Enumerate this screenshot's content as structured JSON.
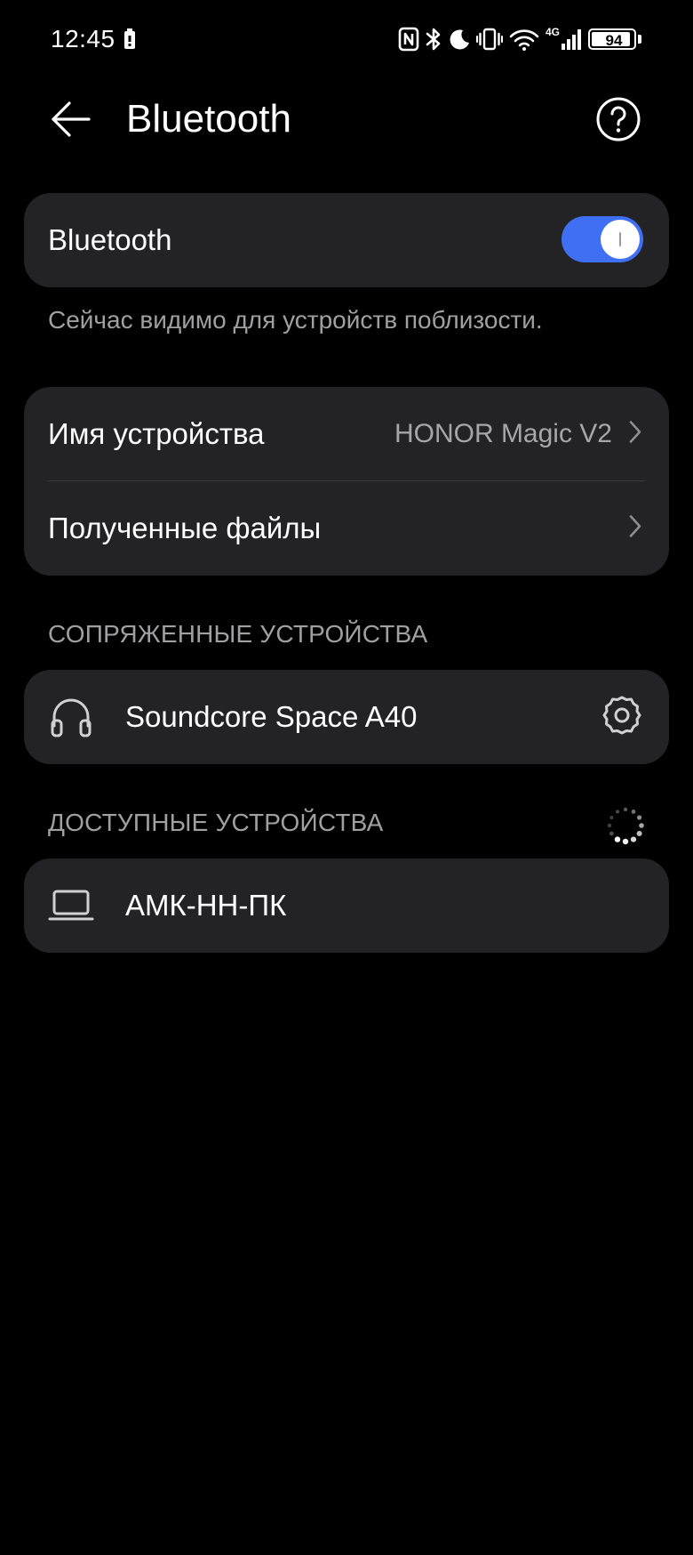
{
  "status_bar": {
    "time": "12:45",
    "battery_level": "94",
    "battery_fraction": 0.94,
    "network_label": "4G",
    "icons": [
      "battery-saver-icon",
      "nfc-icon",
      "bluetooth-icon",
      "moon-icon",
      "vibrate-icon",
      "wifi-icon",
      "cellular-signal-icon",
      "battery-icon"
    ]
  },
  "header": {
    "title": "Bluetooth",
    "back_icon": "arrow-left-icon",
    "help_icon": "help-circle-icon"
  },
  "bluetooth_card": {
    "label": "Bluetooth",
    "enabled": true,
    "accent_color": "#3f6ff2"
  },
  "visibility_hint": "Сейчас видимо для устройств поблизости.",
  "settings_card": {
    "device_name_label": "Имя устройства",
    "device_name_value": "HONOR Magic V2",
    "received_files_label": "Полученные файлы"
  },
  "paired_section": {
    "title": "СОПРЯЖЕННЫЕ УСТРОЙСТВА",
    "devices": [
      {
        "name": "Soundcore Space A40",
        "icon": "headphones-icon",
        "action_icon": "gear-icon"
      }
    ]
  },
  "available_section": {
    "title": "ДОСТУПНЫЕ УСТРОЙСТВА",
    "loading_icon": "loading-spinner-icon",
    "devices": [
      {
        "name": "АМК-НН-ПК",
        "icon": "laptop-icon"
      }
    ]
  }
}
